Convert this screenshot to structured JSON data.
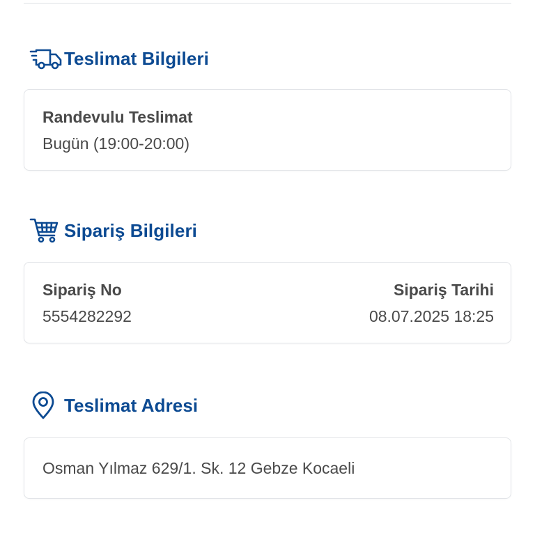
{
  "delivery_section": {
    "title": "Teslimat Bilgileri",
    "icon": "delivery-truck-icon",
    "type_label": "Randevulu Teslimat",
    "time_value": "Bugün (19:00-20:00)"
  },
  "order_section": {
    "title": "Sipariş Bilgileri",
    "icon": "shopping-cart-icon",
    "order_no_label": "Sipariş No",
    "order_no_value": "5554282292",
    "order_date_label": "Sipariş Tarihi",
    "order_date_value": "08.07.2025 18:25"
  },
  "address_section": {
    "title": "Teslimat Adresi",
    "icon": "location-pin-icon",
    "address_value": "Osman Yılmaz 629/1. Sk. 12 Gebze Kocaeli"
  },
  "colors": {
    "accent": "#0c4a92",
    "text": "#4a4a4a",
    "card_border": "#e2e4e8"
  }
}
